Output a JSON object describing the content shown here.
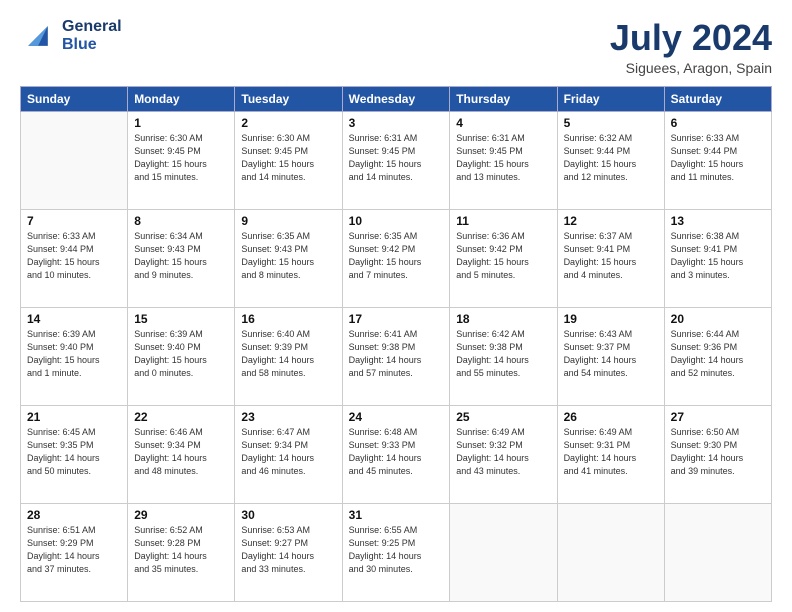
{
  "header": {
    "logo_line1": "General",
    "logo_line2": "Blue",
    "title": "July 2024",
    "location": "Siguees, Aragon, Spain"
  },
  "days_of_week": [
    "Sunday",
    "Monday",
    "Tuesday",
    "Wednesday",
    "Thursday",
    "Friday",
    "Saturday"
  ],
  "weeks": [
    [
      {
        "day": "",
        "info": ""
      },
      {
        "day": "1",
        "info": "Sunrise: 6:30 AM\nSunset: 9:45 PM\nDaylight: 15 hours\nand 15 minutes."
      },
      {
        "day": "2",
        "info": "Sunrise: 6:30 AM\nSunset: 9:45 PM\nDaylight: 15 hours\nand 14 minutes."
      },
      {
        "day": "3",
        "info": "Sunrise: 6:31 AM\nSunset: 9:45 PM\nDaylight: 15 hours\nand 14 minutes."
      },
      {
        "day": "4",
        "info": "Sunrise: 6:31 AM\nSunset: 9:45 PM\nDaylight: 15 hours\nand 13 minutes."
      },
      {
        "day": "5",
        "info": "Sunrise: 6:32 AM\nSunset: 9:44 PM\nDaylight: 15 hours\nand 12 minutes."
      },
      {
        "day": "6",
        "info": "Sunrise: 6:33 AM\nSunset: 9:44 PM\nDaylight: 15 hours\nand 11 minutes."
      }
    ],
    [
      {
        "day": "7",
        "info": "Sunrise: 6:33 AM\nSunset: 9:44 PM\nDaylight: 15 hours\nand 10 minutes."
      },
      {
        "day": "8",
        "info": "Sunrise: 6:34 AM\nSunset: 9:43 PM\nDaylight: 15 hours\nand 9 minutes."
      },
      {
        "day": "9",
        "info": "Sunrise: 6:35 AM\nSunset: 9:43 PM\nDaylight: 15 hours\nand 8 minutes."
      },
      {
        "day": "10",
        "info": "Sunrise: 6:35 AM\nSunset: 9:42 PM\nDaylight: 15 hours\nand 7 minutes."
      },
      {
        "day": "11",
        "info": "Sunrise: 6:36 AM\nSunset: 9:42 PM\nDaylight: 15 hours\nand 5 minutes."
      },
      {
        "day": "12",
        "info": "Sunrise: 6:37 AM\nSunset: 9:41 PM\nDaylight: 15 hours\nand 4 minutes."
      },
      {
        "day": "13",
        "info": "Sunrise: 6:38 AM\nSunset: 9:41 PM\nDaylight: 15 hours\nand 3 minutes."
      }
    ],
    [
      {
        "day": "14",
        "info": "Sunrise: 6:39 AM\nSunset: 9:40 PM\nDaylight: 15 hours\nand 1 minute."
      },
      {
        "day": "15",
        "info": "Sunrise: 6:39 AM\nSunset: 9:40 PM\nDaylight: 15 hours\nand 0 minutes."
      },
      {
        "day": "16",
        "info": "Sunrise: 6:40 AM\nSunset: 9:39 PM\nDaylight: 14 hours\nand 58 minutes."
      },
      {
        "day": "17",
        "info": "Sunrise: 6:41 AM\nSunset: 9:38 PM\nDaylight: 14 hours\nand 57 minutes."
      },
      {
        "day": "18",
        "info": "Sunrise: 6:42 AM\nSunset: 9:38 PM\nDaylight: 14 hours\nand 55 minutes."
      },
      {
        "day": "19",
        "info": "Sunrise: 6:43 AM\nSunset: 9:37 PM\nDaylight: 14 hours\nand 54 minutes."
      },
      {
        "day": "20",
        "info": "Sunrise: 6:44 AM\nSunset: 9:36 PM\nDaylight: 14 hours\nand 52 minutes."
      }
    ],
    [
      {
        "day": "21",
        "info": "Sunrise: 6:45 AM\nSunset: 9:35 PM\nDaylight: 14 hours\nand 50 minutes."
      },
      {
        "day": "22",
        "info": "Sunrise: 6:46 AM\nSunset: 9:34 PM\nDaylight: 14 hours\nand 48 minutes."
      },
      {
        "day": "23",
        "info": "Sunrise: 6:47 AM\nSunset: 9:34 PM\nDaylight: 14 hours\nand 46 minutes."
      },
      {
        "day": "24",
        "info": "Sunrise: 6:48 AM\nSunset: 9:33 PM\nDaylight: 14 hours\nand 45 minutes."
      },
      {
        "day": "25",
        "info": "Sunrise: 6:49 AM\nSunset: 9:32 PM\nDaylight: 14 hours\nand 43 minutes."
      },
      {
        "day": "26",
        "info": "Sunrise: 6:49 AM\nSunset: 9:31 PM\nDaylight: 14 hours\nand 41 minutes."
      },
      {
        "day": "27",
        "info": "Sunrise: 6:50 AM\nSunset: 9:30 PM\nDaylight: 14 hours\nand 39 minutes."
      }
    ],
    [
      {
        "day": "28",
        "info": "Sunrise: 6:51 AM\nSunset: 9:29 PM\nDaylight: 14 hours\nand 37 minutes."
      },
      {
        "day": "29",
        "info": "Sunrise: 6:52 AM\nSunset: 9:28 PM\nDaylight: 14 hours\nand 35 minutes."
      },
      {
        "day": "30",
        "info": "Sunrise: 6:53 AM\nSunset: 9:27 PM\nDaylight: 14 hours\nand 33 minutes."
      },
      {
        "day": "31",
        "info": "Sunrise: 6:55 AM\nSunset: 9:25 PM\nDaylight: 14 hours\nand 30 minutes."
      },
      {
        "day": "",
        "info": ""
      },
      {
        "day": "",
        "info": ""
      },
      {
        "day": "",
        "info": ""
      }
    ]
  ]
}
